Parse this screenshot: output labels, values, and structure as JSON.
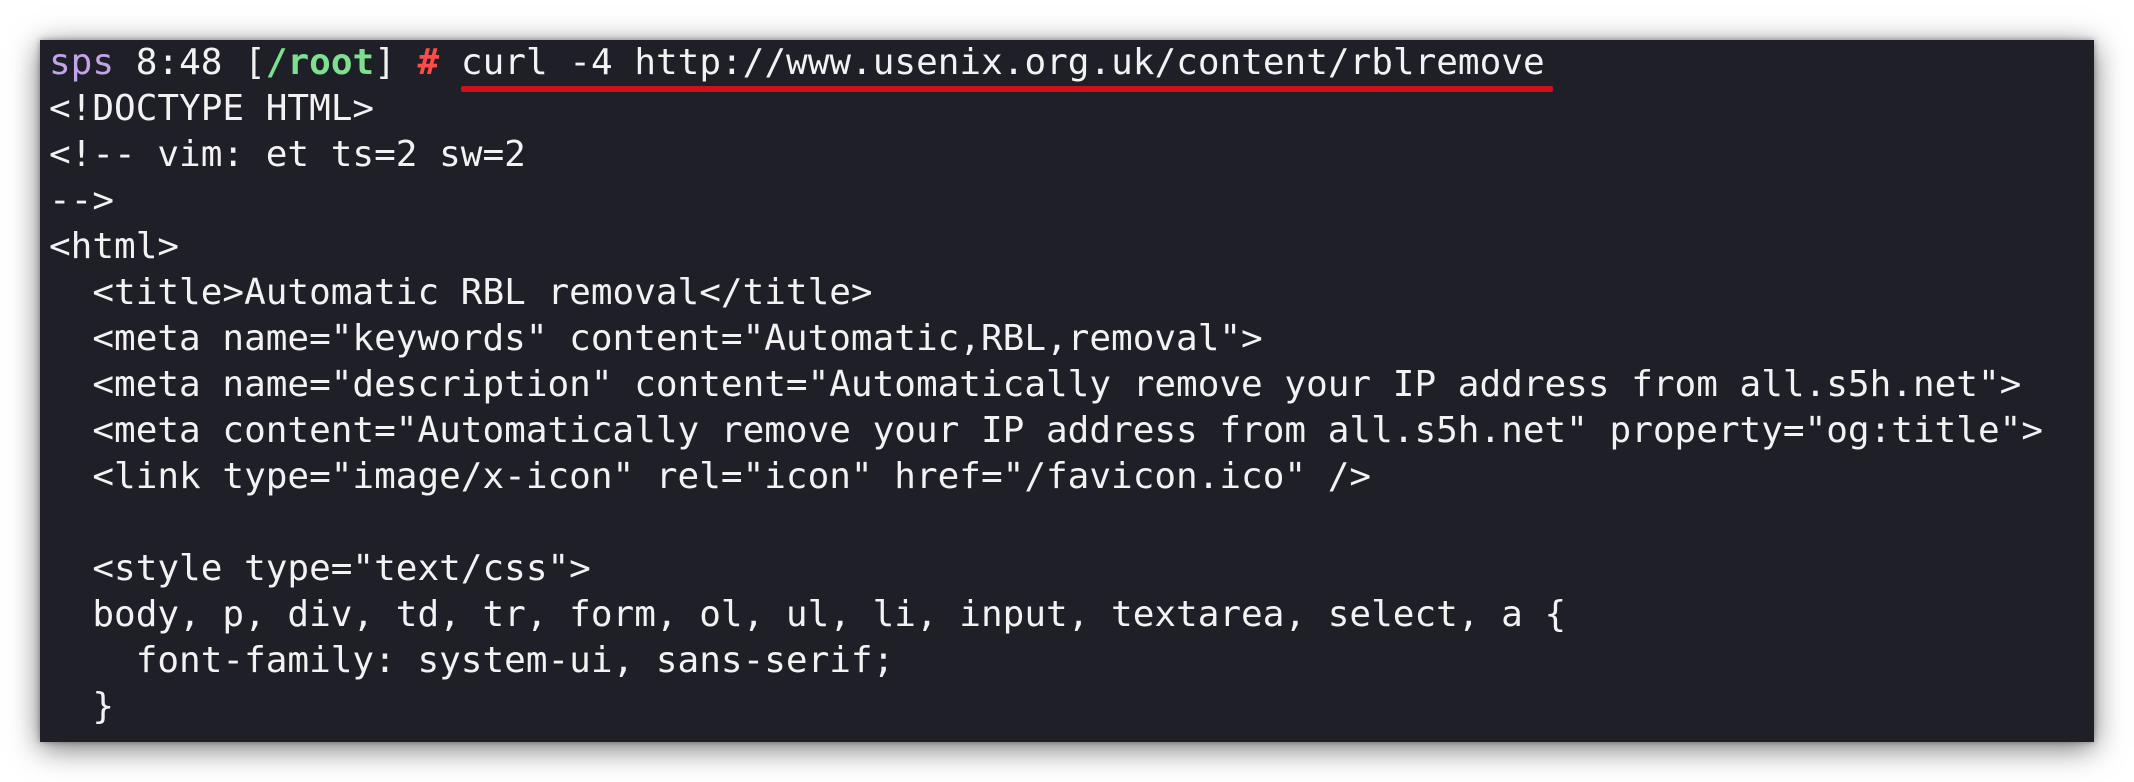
{
  "prompt": {
    "user": "sps",
    "time": "8:48",
    "bracket_open": "[",
    "path": "/root",
    "bracket_close": "]",
    "symbol": "#",
    "command": "curl -4 http://www.usenix.org.uk/content/rblremove"
  },
  "output": [
    "<!DOCTYPE HTML>",
    "<!-- vim: et ts=2 sw=2",
    "-->",
    "<html>",
    "  <title>Automatic RBL removal</title>",
    "  <meta name=\"keywords\" content=\"Automatic,RBL,removal\">",
    "  <meta name=\"description\" content=\"Automatically remove your IP address from all.s5h.net\">",
    "  <meta content=\"Automatically remove your IP address from all.s5h.net\" property=\"og:title\">",
    "  <link type=\"image/x-icon\" rel=\"icon\" href=\"/favicon.ico\" />",
    "",
    "  <style type=\"text/css\">",
    "  body, p, div, td, tr, form, ol, ul, li, input, textarea, select, a {",
    "    font-family: system-ui, sans-serif;",
    "  }"
  ],
  "colors": {
    "background": "#1f1f28",
    "text": "#f2f2f2",
    "user": "#c3a3ea",
    "path": "#7ee08f",
    "root_symbol": "#ff4a4a",
    "highlight_underline": "#d0101a"
  }
}
